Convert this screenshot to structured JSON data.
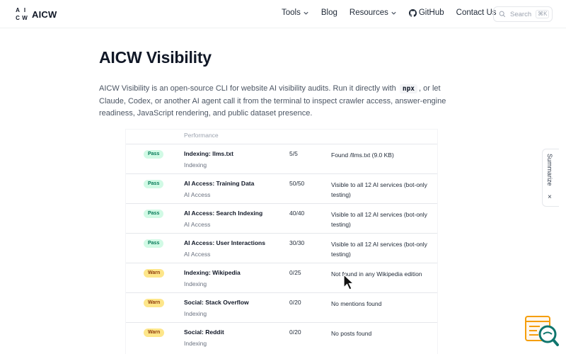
{
  "header": {
    "logo_letters": [
      "A",
      "I",
      "C",
      "W"
    ],
    "brand": "AICW",
    "nav": {
      "tools": "Tools",
      "blog": "Blog",
      "resources": "Resources",
      "github": "GitHub",
      "contact": "Contact Us"
    },
    "search": {
      "placeholder": "Search",
      "shortcut": "⌘K"
    }
  },
  "main": {
    "title": "AICW Visibility",
    "description": {
      "before_code": "AICW Visibility is an open-source CLI for website AI visibility audits. Run it directly with",
      "code": "npx",
      "after_code": ", or let Claude, Codex, or another AI agent call it from the terminal to inspect crawler access, answer-engine readiness, JavaScript rendering, and public dataset presence."
    }
  },
  "report": {
    "partial_heading": "Performance",
    "rows": [
      {
        "status": "Pass",
        "name": "Indexing: llms.txt",
        "category": "Indexing",
        "score": "5/5",
        "detail": "Found /llms.txt (9.0 KB)"
      },
      {
        "status": "Pass",
        "name": "AI Access: Training Data",
        "category": "AI Access",
        "score": "50/50",
        "detail": "Visible to all 12 AI services (bot-only testing)"
      },
      {
        "status": "Pass",
        "name": "AI Access: Search Indexing",
        "category": "AI Access",
        "score": "40/40",
        "detail": "Visible to all 12 AI services (bot-only testing)"
      },
      {
        "status": "Pass",
        "name": "AI Access: User Interactions",
        "category": "AI Access",
        "score": "30/30",
        "detail": "Visible to all 12 AI services (bot-only testing)"
      },
      {
        "status": "Warn",
        "name": "Indexing: Wikipedia",
        "category": "Indexing",
        "score": "0/25",
        "detail": "Not found in any Wikipedia edition"
      },
      {
        "status": "Warn",
        "name": "Social: Stack Overflow",
        "category": "Indexing",
        "score": "0/20",
        "detail": "No mentions found"
      },
      {
        "status": "Warn",
        "name": "Social: Reddit",
        "category": "Indexing",
        "score": "0/20",
        "detail": "No posts found"
      }
    ]
  },
  "summarize": {
    "label": "Summarize",
    "close": "×"
  },
  "colors": {
    "pass_bg": "#d1fae5",
    "pass_text": "#047857",
    "warn_bg": "#fde68a",
    "warn_text": "#92400e",
    "widget_accent": "#f59e0b",
    "widget_teal": "#0f766e"
  }
}
